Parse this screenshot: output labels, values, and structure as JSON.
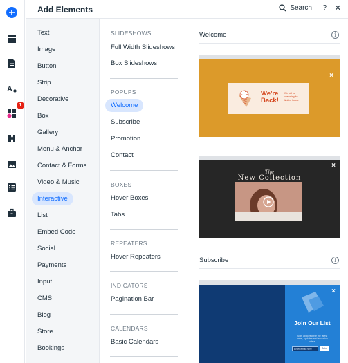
{
  "header": {
    "title": "Add Elements",
    "search_label": "Search",
    "help_label": "?",
    "close_label": "✕"
  },
  "rail": {
    "badge_count": "1",
    "items": [
      "add-icon",
      "pages-icon",
      "page-icon",
      "theme-icon",
      "apps-icon",
      "puzzle-icon",
      "media-icon",
      "cms-icon",
      "business-icon"
    ]
  },
  "categories": [
    "Text",
    "Image",
    "Button",
    "Strip",
    "Decorative",
    "Box",
    "Gallery",
    "Menu & Anchor",
    "Contact & Forms",
    "Video & Music",
    "Interactive",
    "List",
    "Embed Code",
    "Social",
    "Payments",
    "Input",
    "CMS",
    "Blog",
    "Store",
    "Bookings"
  ],
  "selected_category": "Interactive",
  "subcategories": {
    "slideshows": {
      "heading": "SLIDESHOWS",
      "items": [
        "Full Width Slideshows",
        "Box Slideshows"
      ]
    },
    "popups": {
      "heading": "POPUPS",
      "items": [
        "Welcome",
        "Subscribe",
        "Promotion",
        "Contact"
      ]
    },
    "boxes": {
      "heading": "BOXES",
      "items": [
        "Hover Boxes",
        "Tabs"
      ]
    },
    "repeaters": {
      "heading": "REPEATERS",
      "items": [
        "Hover Repeaters"
      ]
    },
    "indicators": {
      "heading": "INDICATORS",
      "items": [
        "Pagination Bar"
      ]
    },
    "calendars": {
      "heading": "CALENDARS",
      "items": [
        "Basic Calendars"
      ]
    }
  },
  "selected_subcategory": "Welcome",
  "previews": {
    "welcome": {
      "title": "Welcome",
      "info": "i",
      "card1": {
        "headline": "We're Back!",
        "body": "We will be operating for limited hours.",
        "close": "×"
      },
      "card2": {
        "script": "The",
        "title": "New Collection",
        "close": "×"
      }
    },
    "subscribe": {
      "title": "Subscribe",
      "info": "i",
      "card3": {
        "headline": "Join Our List",
        "body": "Sign up to receive the latest news, updates and exclusive offers.",
        "input_placeholder": "Enter email here",
        "button": "Join",
        "close": "×"
      }
    }
  },
  "colors": {
    "accent": "#116dff",
    "selected_bg": "#d8e6fe",
    "badge": "#e62214",
    "card1_bg": "#dc9a2a",
    "card1_text": "#d4441c",
    "card2_bg": "#262626",
    "card3_dark": "#0f3a73",
    "card3_light": "#2380d6"
  }
}
